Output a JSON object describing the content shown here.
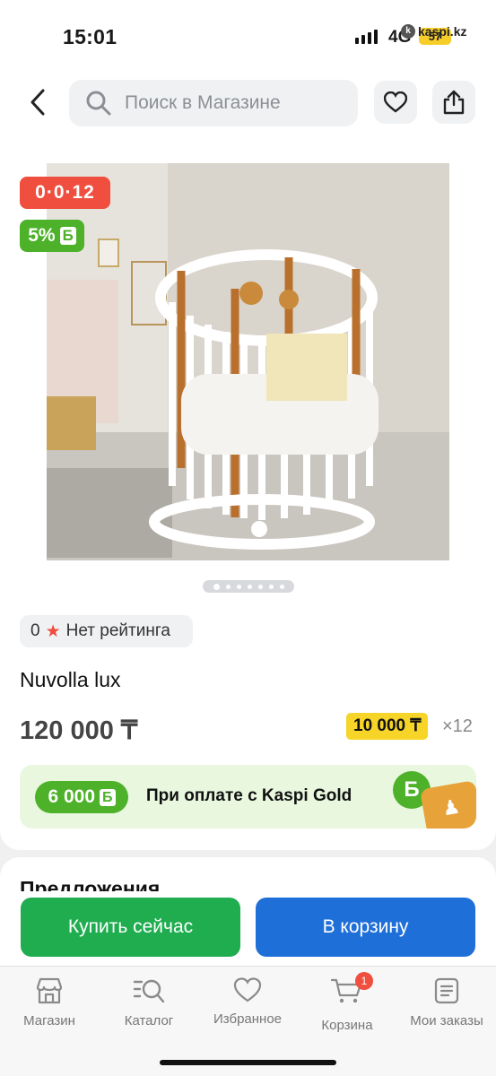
{
  "status_bar": {
    "time": "15:01",
    "network": "4G",
    "battery": "57",
    "site": "kaspi.kz"
  },
  "header": {
    "search_placeholder": "Поиск в Магазине"
  },
  "product": {
    "promo_badge": "0·0·12",
    "bonus_badge": "5%",
    "bonus_currency": "Б",
    "rating_value": "0",
    "rating_text": "Нет рейтинга",
    "name": "Nuvolla lux",
    "price": "120 000 ₸",
    "installment_amount": "10 000 ₸",
    "installment_months": "×12",
    "image_count": 7,
    "active_image": 0
  },
  "kaspi_gold": {
    "bonus_amount": "6 000",
    "bonus_currency": "Б",
    "text": "При оплате с Kaspi Gold"
  },
  "offers": {
    "title": "Предложения"
  },
  "actions": {
    "buy_now": "Купить сейчас",
    "add_to_cart": "В корзину"
  },
  "nav": {
    "items": [
      {
        "label": "Магазин",
        "icon": "store-icon"
      },
      {
        "label": "Каталог",
        "icon": "catalog-icon"
      },
      {
        "label": "Избранное",
        "icon": "heart-icon"
      },
      {
        "label": "Корзина",
        "icon": "cart-icon",
        "badge": "1"
      },
      {
        "label": "Мои заказы",
        "icon": "orders-icon"
      }
    ]
  },
  "colors": {
    "red": "#f04e3e",
    "green": "#4db12a",
    "buy_green": "#1fad50",
    "cart_blue": "#1f6fd8",
    "yellow": "#f7d428"
  }
}
